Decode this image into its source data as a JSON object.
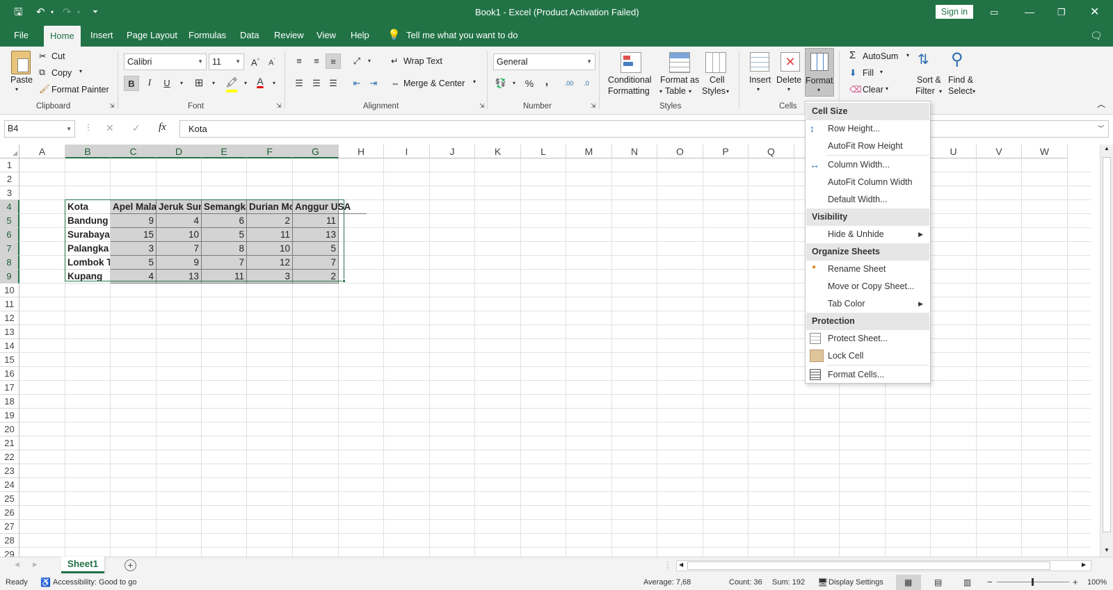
{
  "window": {
    "title": "Book1  -  Excel (Product Activation Failed)",
    "sign_in": "Sign in"
  },
  "tabs": [
    "File",
    "Home",
    "Insert",
    "Page Layout",
    "Formulas",
    "Data",
    "Review",
    "View",
    "Help"
  ],
  "tell_me": "Tell me what you want to do",
  "ribbon": {
    "clipboard": {
      "paste": "Paste",
      "cut": "Cut",
      "copy": "Copy",
      "format_painter": "Format Painter",
      "group": "Clipboard"
    },
    "font": {
      "name": "Calibri",
      "size": "11",
      "bold": "B",
      "italic": "I",
      "underline": "U",
      "group": "Font"
    },
    "alignment": {
      "wrap": "Wrap Text",
      "merge": "Merge & Center",
      "group": "Alignment"
    },
    "number": {
      "format": "General",
      "percent": "%",
      "comma": ",",
      "group": "Number"
    },
    "styles": {
      "conditional": "Conditional",
      "conditional2": "Formatting",
      "format_table": "Format as",
      "format_table2": "Table",
      "cell_styles": "Cell",
      "cell_styles2": "Styles",
      "group": "Styles"
    },
    "cells": {
      "insert": "Insert",
      "delete": "Delete",
      "format": "Format",
      "group": "Cells"
    },
    "editing": {
      "autosum": "AutoSum",
      "fill": "Fill",
      "clear": "Clear",
      "sort": "Sort &",
      "sort2": "Filter",
      "find": "Find &",
      "find2": "Select"
    }
  },
  "formula_bar": {
    "name_box": "B4",
    "fx": "fx",
    "value": "Kota"
  },
  "columns": [
    "A",
    "B",
    "C",
    "D",
    "E",
    "F",
    "G",
    "H",
    "I",
    "J",
    "K",
    "L",
    "M",
    "N",
    "O",
    "P",
    "Q",
    "R",
    "S",
    "T",
    "U",
    "V",
    "W"
  ],
  "rows": [
    "1",
    "2",
    "3",
    "4",
    "5",
    "6",
    "7",
    "8",
    "9",
    "10",
    "11",
    "12",
    "13",
    "14",
    "15",
    "16",
    "17",
    "18",
    "19",
    "20",
    "21",
    "22",
    "23",
    "24",
    "25",
    "26",
    "27",
    "28",
    "29"
  ],
  "table": {
    "headers": [
      "Kota",
      "Apel Mala",
      "Jeruk Sunl",
      "Semangka",
      "Durian Mo",
      "Anggur USA"
    ],
    "rows": [
      [
        "Bandung",
        "9",
        "4",
        "6",
        "2",
        "11"
      ],
      [
        "Surabaya",
        "15",
        "10",
        "5",
        "11",
        "13"
      ],
      [
        "Palangka I",
        "3",
        "7",
        "8",
        "10",
        "5"
      ],
      [
        "Lombok T",
        "5",
        "9",
        "7",
        "12",
        "7"
      ],
      [
        "Kupang",
        "4",
        "13",
        "11",
        "3",
        "2"
      ]
    ]
  },
  "format_menu": {
    "cell_size": "Cell Size",
    "row_height": "Row Height...",
    "autofit_row": "AutoFit Row Height",
    "column_width": "Column Width...",
    "autofit_col": "AutoFit Column Width",
    "default_width": "Default Width...",
    "visibility": "Visibility",
    "hide_unhide": "Hide & Unhide",
    "organize": "Organize Sheets",
    "rename": "Rename Sheet",
    "move_copy": "Move or Copy Sheet...",
    "tab_color": "Tab Color",
    "protection": "Protection",
    "protect": "Protect Sheet...",
    "lock": "Lock Cell",
    "format_cells": "Format Cells..."
  },
  "sheet_tab": "Sheet1",
  "status": {
    "ready": "Ready",
    "accessibility": "Accessibility: Good to go",
    "average": "Average: 7,68",
    "count": "Count: 36",
    "sum": "Sum: 192",
    "display": "Display Settings",
    "zoom": "100%"
  },
  "colors": {
    "accent": "#217346",
    "selection": "#d3d3d3"
  }
}
